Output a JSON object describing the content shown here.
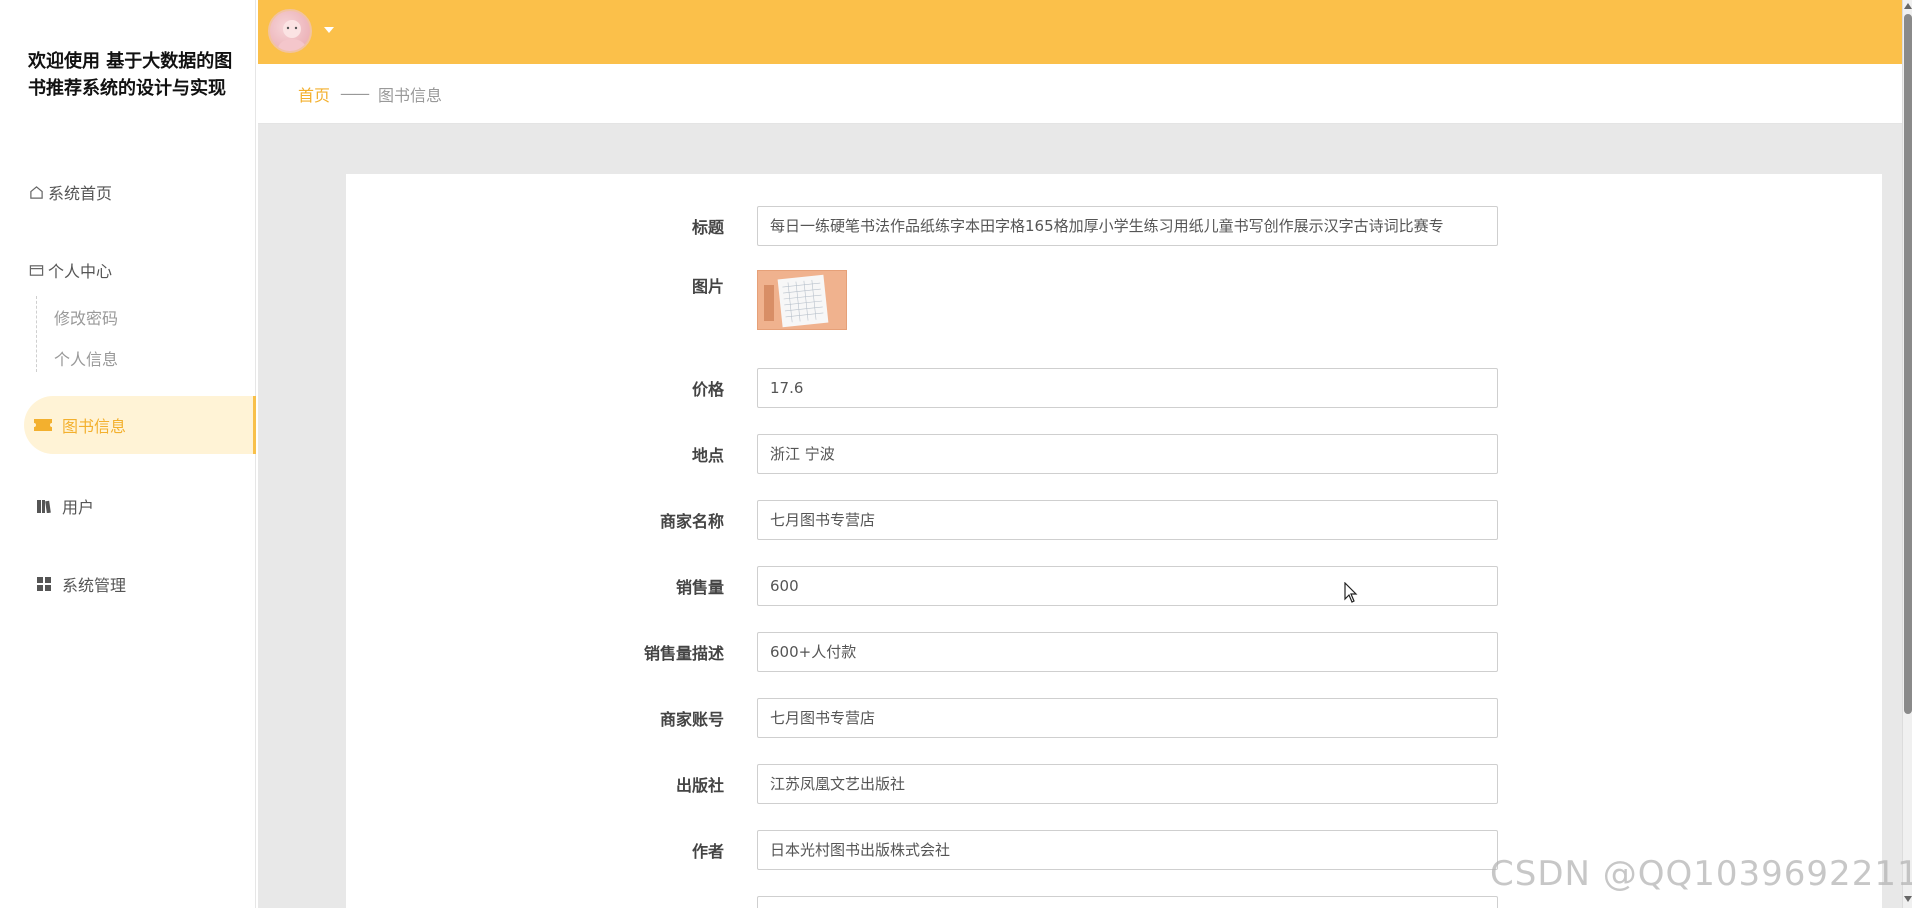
{
  "sidebar": {
    "title": "欢迎使用 基于大数据的图书推荐系统的设计与实现",
    "home": "系统首页",
    "personal_center": "个人中心",
    "sub_items": [
      "修改密码",
      "个人信息"
    ],
    "book_info": "图书信息",
    "users": "用户",
    "system_manage": "系统管理"
  },
  "breadcrumb": {
    "home": "首页",
    "separator": "——",
    "current": "图书信息"
  },
  "form": {
    "title_label": "标题",
    "title_value": "每日一练硬笔书法作品纸练字本田字格165格加厚小学生练习用纸儿童书写创作展示汉字古诗词比赛专",
    "image_label": "图片",
    "price_label": "价格",
    "price_value": "17.6",
    "location_label": "地点",
    "location_value": "浙江 宁波",
    "shop_name_label": "商家名称",
    "shop_name_value": "七月图书专营店",
    "sales_label": "销售量",
    "sales_value": "600",
    "sales_desc_label": "销售量描述",
    "sales_desc_value": "600+人付款",
    "shop_account_label": "商家账号",
    "shop_account_value": "七月图书专营店",
    "publisher_label": "出版社",
    "publisher_value": "江苏凤凰文艺出版社",
    "author_label": "作者",
    "author_value": "日本光村图书出版株式会社"
  },
  "watermark": "CSDN @QQ1039692211",
  "colors": {
    "accent": "#fbc04a",
    "accent_text": "#f3b02e",
    "active_bg": "#fff3d6"
  }
}
